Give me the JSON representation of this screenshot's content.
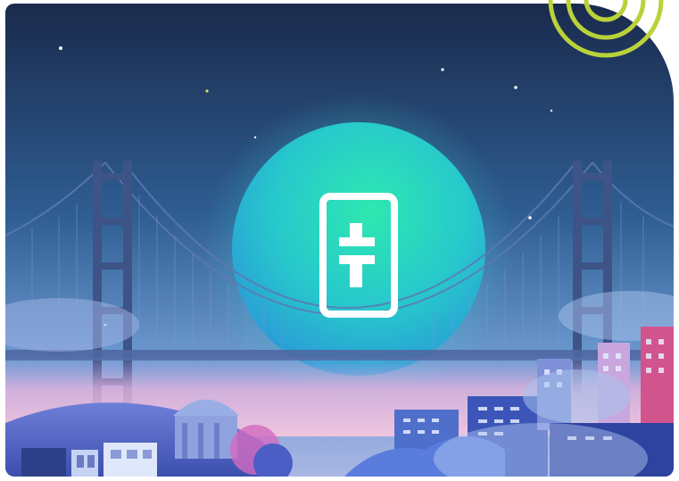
{
  "scene": {
    "subject": "illustration-tether-token-over-golden-gate-bridge",
    "icon": "tether-logo-icon",
    "colors": {
      "sky_top": "#1b2d50",
      "sky_bottom": "#4f8fc9",
      "orb_inner": "#27e2b8",
      "orb_outer": "#2a9fd9",
      "bridge": "#3a4f7c",
      "mist": "#f1b9dc",
      "ring": "#b9d23a",
      "logo_stroke": "#ffffff"
    }
  }
}
